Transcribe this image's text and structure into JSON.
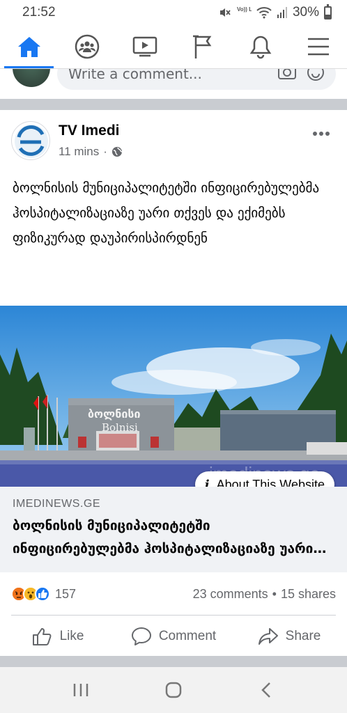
{
  "status_bar": {
    "time": "21:52",
    "battery": "30%",
    "battery_level": 0.3,
    "volte_label": "Vo)) LTE",
    "icons": [
      "mute-icon",
      "volte-icon",
      "wifi-icon",
      "signal-icon",
      "battery-icon"
    ]
  },
  "nav": {
    "items": [
      {
        "name": "home",
        "icon": "home-icon",
        "active": true
      },
      {
        "name": "groups",
        "icon": "groups-icon",
        "active": false
      },
      {
        "name": "watch",
        "icon": "video-icon",
        "active": false
      },
      {
        "name": "pages",
        "icon": "flag-icon",
        "active": false
      },
      {
        "name": "notifications",
        "icon": "bell-icon",
        "active": false
      },
      {
        "name": "menu",
        "icon": "hamburger-icon",
        "active": false
      }
    ],
    "accent": "#1877f2"
  },
  "previous_post": {
    "comment_placeholder": "Write a comment..."
  },
  "post": {
    "page_name": "TV Imedi",
    "time": "11 mins",
    "separator": "·",
    "audience_icon": "globe-icon",
    "text": "ბოლნისის მუნიციპალიტეტში ინფიცირებულებმა ჰოსპიტალიზაციაზე უარი თქვეს და ექიმებს ფიზიკურად დაუპირისპირდნენ",
    "image": {
      "building_sign_georgian": "ბოლნისი",
      "building_sign_latin": "Bolnisi",
      "watermark": "imedinews.ge"
    },
    "about_website": "About This Website",
    "link_domain": "IMEDINEWS.GE",
    "link_title": "ბოლნისის მუნიციპალიტეტში ინფიცირებულებმა ჰოსპიტალიზაციაზე უარი თქვეს და ექიმებს ფიზიკურად დაუპირისპირდნენ",
    "reactions": [
      "angry",
      "wow",
      "like"
    ],
    "reaction_count": "157",
    "comments": "23 comments",
    "dot": "•",
    "shares": "15 shares",
    "actions": {
      "like": "Like",
      "comment": "Comment",
      "share": "Share"
    }
  },
  "system_nav": {
    "buttons": [
      "recents-icon",
      "home-circle-icon",
      "back-icon"
    ]
  }
}
